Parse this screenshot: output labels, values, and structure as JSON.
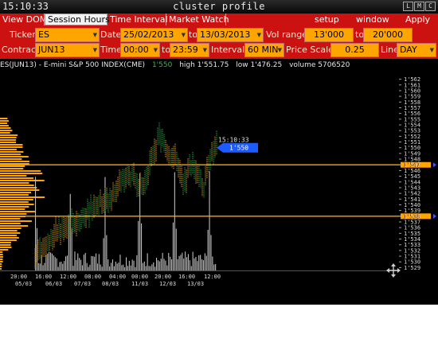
{
  "window": {
    "clock": "15:10:33",
    "title": "cluster profile",
    "btn_l": "L",
    "btn_m": "M",
    "btn_c": "C"
  },
  "menu": {
    "view_dom": "View DOM",
    "session_hours": "Session Hours",
    "time_interval": "Time Interval",
    "market_watch": "Market Watch",
    "setup": "setup",
    "window": "window",
    "apply": "Apply"
  },
  "params": {
    "ticker_label": "Ticker",
    "ticker": "ES",
    "date_label": "Date",
    "date_from": "25/02/2013",
    "to1": "to",
    "date_to": "13/03/2013",
    "vol_label": "Vol range",
    "vol_from": "13'000",
    "to2": "to",
    "vol_to": "20'000",
    "contract_label": "Contract",
    "contract": "JUN13",
    "time_label": "Time",
    "time_from": "00:00",
    "to3": "to",
    "time_to": "23:59",
    "interval_label": "Interval",
    "interval": "60 MIN",
    "price_scale_label": "Price Scale",
    "price_scale": "0.25",
    "line_label": "Line",
    "line": "DAY"
  },
  "chart_info": {
    "symbol": "ES(JUN13) - E-mini S&P 500 INDEX(CME)",
    "last": "1'550",
    "high": "high 1'551.75",
    "low": "low 1'476.25",
    "volume": "volume 5706520"
  },
  "chart_data": {
    "type": "candlestick",
    "y_ticks": [
      "1'562",
      "1'561",
      "1'560",
      "1'559",
      "1'558",
      "1'557",
      "1'556",
      "1'555",
      "1'554",
      "1'553",
      "1'552",
      "1'551",
      "1'550",
      "1'549",
      "1'548",
      "1'547",
      "1'546",
      "1'545",
      "1'544",
      "1'543",
      "1'542",
      "1'541",
      "1'540",
      "1'539",
      "1'538",
      "1'537",
      "1'536",
      "1'535",
      "1'534",
      "1'533",
      "1'532",
      "1'531",
      "1'530",
      "1'529"
    ],
    "x_time_ticks": [
      "20:00",
      "16:00",
      "12:00",
      "08:00",
      "04:00",
      "00:00",
      "20:00",
      "16:00",
      "12:00"
    ],
    "x_date_ticks": [
      "05/03",
      "06/03",
      "07/03",
      "08/03",
      "11/03",
      "12/03",
      "13/03"
    ],
    "price_marker": "1'550",
    "time_marker": "15:10:33",
    "level_upper": "1'547",
    "level_lower": "1'538",
    "level_upper_value": 1547,
    "level_lower_value": 1538,
    "ylim": [
      1528.5,
      1562.5
    ],
    "colors": {
      "up": "#1fa84a",
      "down": "#e0a020",
      "level": "#ffa500",
      "marker": "#1e5bff",
      "profile": "#ffa500",
      "volume": "#bdbdbd"
    }
  }
}
